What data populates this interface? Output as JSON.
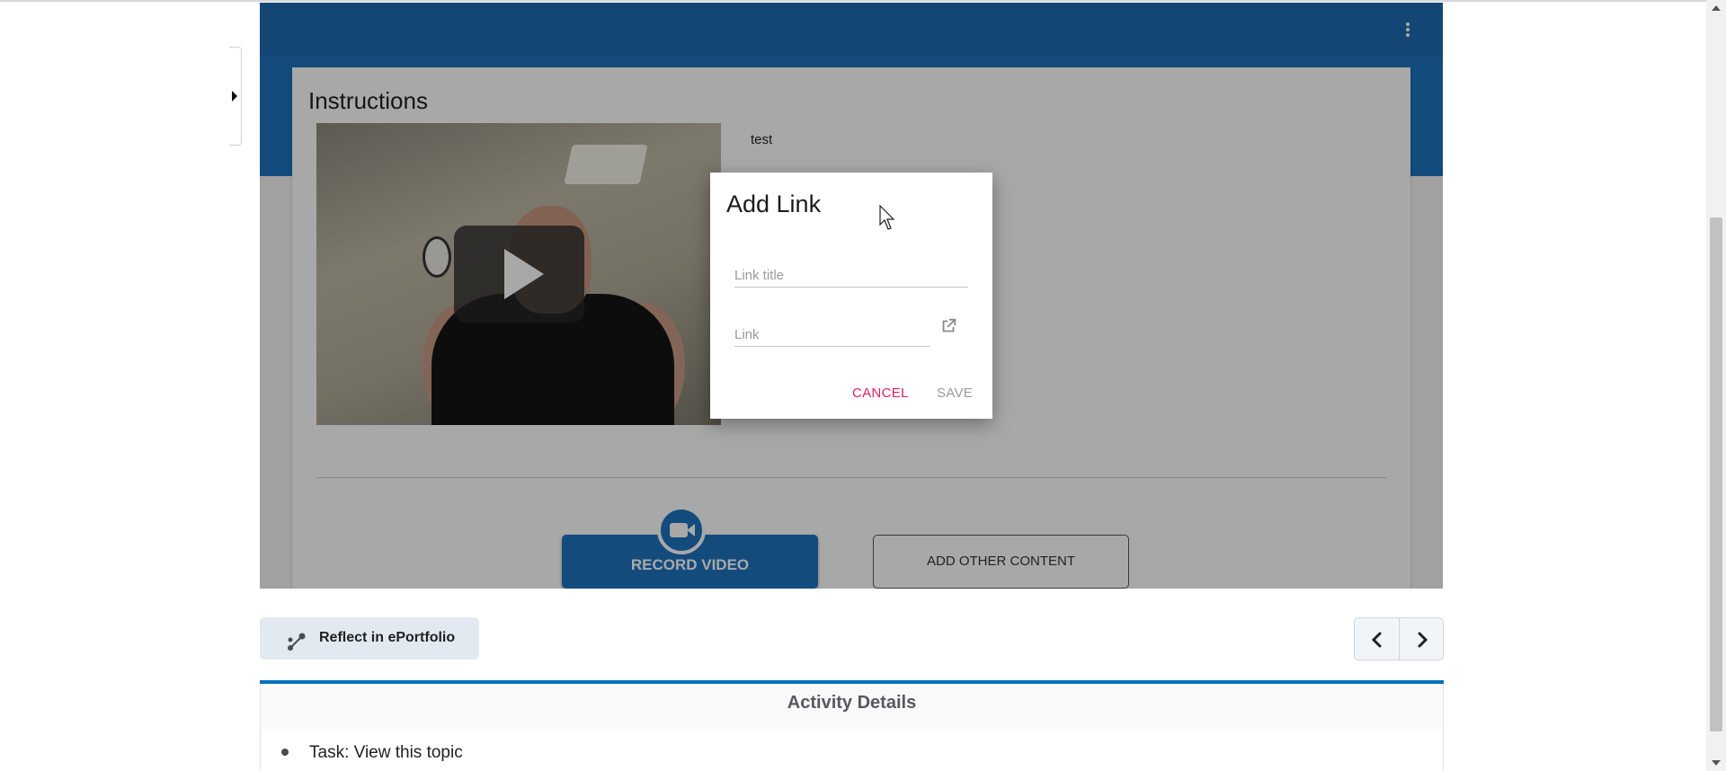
{
  "frame": {
    "card_title": "Instructions",
    "card_text": "test",
    "record_video_label": "RECORD VIDEO",
    "add_other_content_label": "ADD OTHER CONTENT",
    "menu_icon": "more-vertical-icon",
    "play_icon": "play-icon",
    "camera_icon": "video-camera-icon"
  },
  "dialog": {
    "title": "Add Link",
    "link_title_placeholder": "Link title",
    "link_placeholder": "Link",
    "open_link_icon": "open-in-new-icon",
    "cancel_label": "CANCEL",
    "save_label": "SAVE"
  },
  "footer": {
    "reflect_label": "Reflect in ePortfolio",
    "reflect_icon": "share-nodes-icon",
    "prev_icon": "chevron-left-icon",
    "next_icon": "chevron-right-icon"
  },
  "activity": {
    "heading": "Activity Details",
    "items": [
      "Task: View this topic"
    ]
  },
  "colors": {
    "brand_blue": "#1e73be",
    "cancel_pink": "#e21f5f",
    "details_bar": "#006fbf"
  }
}
